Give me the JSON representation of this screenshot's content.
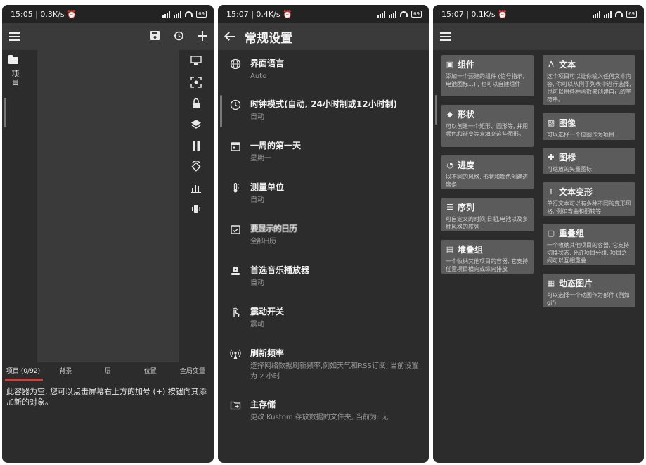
{
  "panel1": {
    "status": {
      "time": "15:05",
      "speed": "0.3K/s",
      "battery": "69"
    },
    "side_label": "项目",
    "tabs": [
      {
        "label": "项目 (0/92)"
      },
      {
        "label": "背景"
      },
      {
        "label": "层"
      },
      {
        "label": "位置"
      },
      {
        "label": "全局变量"
      }
    ],
    "empty_message": "此容器为空, 您可以点击屏幕右上方的加号 (+) 按钮向其添加新的对象。"
  },
  "panel2": {
    "status": {
      "time": "15:07",
      "speed": "0.4K/s",
      "battery": "69"
    },
    "title": "常规设置",
    "settings": [
      {
        "icon": "globe-icon",
        "title": "界面语言",
        "subtitle": "Auto"
      },
      {
        "icon": "clock-icon",
        "title": "时钟模式(自动, 24小时制或12小时制)",
        "subtitle": "自动"
      },
      {
        "icon": "calendar-icon",
        "title": "一周的第一天",
        "subtitle": "星期一"
      },
      {
        "icon": "thermometer-icon",
        "title": "测量单位",
        "subtitle": "自动"
      },
      {
        "icon": "calendar-check-icon",
        "title": "要显示的日历",
        "subtitle": "全部日历"
      },
      {
        "icon": "music-player-icon",
        "title": "首选音乐播放器",
        "subtitle": "自动"
      },
      {
        "icon": "touch-icon",
        "title": "震动开关",
        "subtitle": "震动"
      },
      {
        "icon": "antenna-icon",
        "title": "刷新频率",
        "subtitle": "选择网络数据刷新频率,例如天气和RSS订阅, 当前设置为 2 小时"
      },
      {
        "icon": "folder-storage-icon",
        "title": "主存储",
        "subtitle": "更改 Kustom 存放数据的文件夹, 当前为: 无"
      }
    ]
  },
  "panel3": {
    "status": {
      "time": "15:07",
      "speed": "0.1K/s",
      "battery": "69"
    },
    "left_cards": [
      {
        "icon": "component-icon",
        "title": "组件",
        "desc": "添加一个预建的组件 (信号指示, 电池图标...) , 也可以自建组件"
      },
      {
        "icon": "shape-icon",
        "title": "形状",
        "desc": "可以创建一个矩形、圆形等, 并用颜色和渐变等来填充这些图形。"
      },
      {
        "icon": "progress-icon",
        "title": "进度",
        "desc": "以不同的风格, 形状和颜色创建进度条"
      },
      {
        "icon": "list-icon",
        "title": "序列",
        "desc": "可自定义的时间,日期,电池以及多种风格的序列"
      },
      {
        "icon": "stack-icon",
        "title": "堆叠组",
        "desc": "一个收纳其他项目的容器, 它支持任意项目横向或纵向排放"
      }
    ],
    "right_cards": [
      {
        "icon": "text-icon",
        "title": "文本",
        "desc": "这个项目可以让你输入任何文本内容, 你可以从例子列表中进行选择, 也可以用各种函数来创建自己的字符串。"
      },
      {
        "icon": "image-icon",
        "title": "图像",
        "desc": "可以选择一个位图作为项目"
      },
      {
        "icon": "puzzle-icon",
        "title": "图标",
        "desc": "可缩放的矢量图标"
      },
      {
        "icon": "text-transform-icon",
        "title": "文本变形",
        "desc": "单行文本可以有多种不同的变形风格, 例如弯曲和翻转等"
      },
      {
        "icon": "overlap-icon",
        "title": "重叠组",
        "desc": "一个收纳其他项目的容器, 它支持切换状态, 允许项目分组, 项目之间可以互相重叠"
      },
      {
        "icon": "movie-icon",
        "title": "动态图片",
        "desc": "可以选择一个动图作为部件 (例如gif)"
      }
    ]
  },
  "colors": {
    "accent": "#e53935",
    "card": "#5b5b5b",
    "bg": "#2c2c2c"
  }
}
